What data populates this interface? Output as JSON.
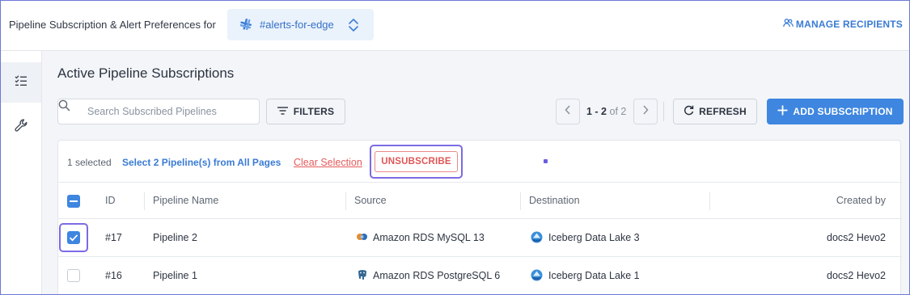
{
  "header": {
    "title": "Pipeline Subscription & Alert Preferences for",
    "channel": "#alerts-for-edge",
    "manage_recipients": "MANAGE RECIPIENTS"
  },
  "main": {
    "page_title": "Active Pipeline Subscriptions",
    "search_placeholder": "Search Subscribed Pipelines",
    "filters_label": "FILTERS",
    "pager": {
      "range": "1 - 2",
      "of_total": "of 2"
    },
    "refresh_label": "REFRESH",
    "add_label": "ADD SUBSCRIPTION"
  },
  "selection": {
    "count_text": "1 selected",
    "select_all_text": "Select 2 Pipeline(s) from All Pages",
    "clear_text": "Clear Selection",
    "unsubscribe_label": "UNSUBSCRIBE"
  },
  "table": {
    "columns": [
      "ID",
      "Pipeline Name",
      "Source",
      "Destination",
      "Created by"
    ],
    "rows": [
      {
        "checked": true,
        "id": "#17",
        "name": "Pipeline 2",
        "source": "Amazon RDS MySQL 13",
        "source_icon": "mysql-icon",
        "destination": "Iceberg Data Lake 3",
        "destination_icon": "iceberg-icon",
        "created_by": "docs2 Hevo2"
      },
      {
        "checked": false,
        "id": "#16",
        "name": "Pipeline 1",
        "source": "Amazon RDS PostgreSQL 6",
        "source_icon": "postgres-icon",
        "destination": "Iceberg Data Lake 1",
        "destination_icon": "iceberg-icon",
        "created_by": "docs2 Hevo2"
      }
    ]
  },
  "colors": {
    "accent": "#3e86e0",
    "link": "#3a7bd5",
    "danger": "#e05656",
    "highlight": "#7b6be3",
    "background": "#f3f5f8"
  }
}
